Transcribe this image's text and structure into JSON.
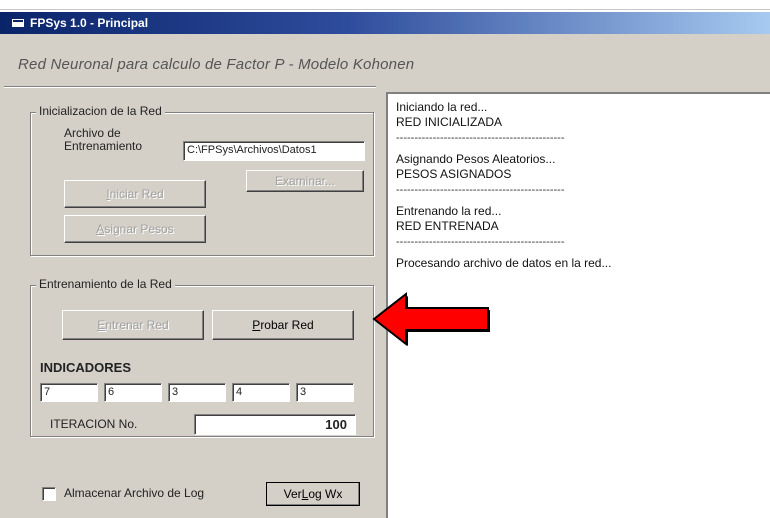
{
  "window": {
    "title": "FPSys 1.0 - Principal",
    "subtitle": "Red Neuronal para calculo de Factor P - Modelo Kohonen"
  },
  "init_group": {
    "legend": "Inicializacion de la Red",
    "file_label_line1": "Archivo de",
    "file_label_line2": "Entrenamiento",
    "file_path": "C:\\FPSys\\Archivos\\Datos1",
    "browse_button": "Examinar...",
    "start_button_mnemonic": "I",
    "start_button_rest": "niciar Red",
    "assign_button_mnemonic": "A",
    "assign_button_rest": "signar Pesos"
  },
  "training_group": {
    "legend": "Entrenamiento de la Red",
    "train_button_mnemonic": "E",
    "train_button_rest": "ntrenar Red",
    "test_button_mnemonic": "P",
    "test_button_rest": "robar Red",
    "indicators_label": "INDICADORES",
    "indicators": [
      "7",
      "6",
      "3",
      "4",
      "3"
    ],
    "iteration_label": "ITERACION No.",
    "iteration_value": "100"
  },
  "footer": {
    "log_checkbox_label": "Almacenar Archivo de Log",
    "view_log_prefix": "Ver ",
    "view_log_mnemonic": "L",
    "view_log_rest": "og Wx"
  },
  "log": {
    "lines": [
      "Iniciando la red...",
      "RED INICIALIZADA",
      "----------------------------------------------",
      "Asignando Pesos Aleatorios...",
      "PESOS ASIGNADOS",
      "----------------------------------------------",
      "Entrenando la red...",
      "RED ENTRENADA",
      "----------------------------------------------",
      "Procesando archivo de datos en la red..."
    ]
  },
  "colors": {
    "titlebar_start": "#0a246a",
    "titlebar_end": "#a6caf0",
    "face": "#d4d0c8",
    "arrow": "#ff0000"
  },
  "icons": {
    "app": "app-icon",
    "annotation": "red-arrow-icon"
  }
}
